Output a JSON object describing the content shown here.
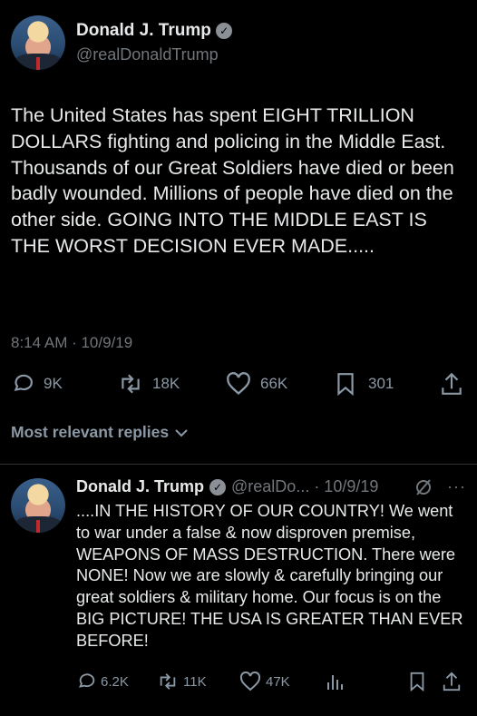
{
  "main_tweet": {
    "author_name": "Donald J. Trump",
    "handle": "@realDonaldTrump",
    "body": "The United States has spent EIGHT TRILLION DOLLARS fighting and policing in the Middle East. Thousands of our Great Soldiers have died or been badly wounded. Millions of people have died on the other side. GOING INTO THE MIDDLE EAST IS THE WORST DECISION EVER MADE.....",
    "timestamp": "8:14 AM · 10/9/19",
    "replies": "9K",
    "retweets": "18K",
    "likes": "66K",
    "bookmarks": "301"
  },
  "replies_section": {
    "label": "Most relevant replies"
  },
  "reply_tweet": {
    "author_name": "Donald J. Trump",
    "handle_date": "@realDo... · 10/9/19",
    "body": "....IN THE HISTORY OF OUR COUNTRY! We went to war under a false & now disproven premise, WEAPONS OF MASS DESTRUCTION. There were NONE! Now we are slowly & carefully bringing our great soldiers & military home. Our focus is on the BIG PICTURE! THE USA IS GREATER THAN EVER BEFORE!",
    "replies": "6.2K",
    "retweets": "11K",
    "likes": "47K"
  },
  "icons": [
    "verified-icon",
    "reply-icon",
    "retweet-icon",
    "like-icon",
    "bookmark-icon",
    "share-icon",
    "chevron-down-icon",
    "grok-icon",
    "more-icon",
    "views-icon"
  ]
}
